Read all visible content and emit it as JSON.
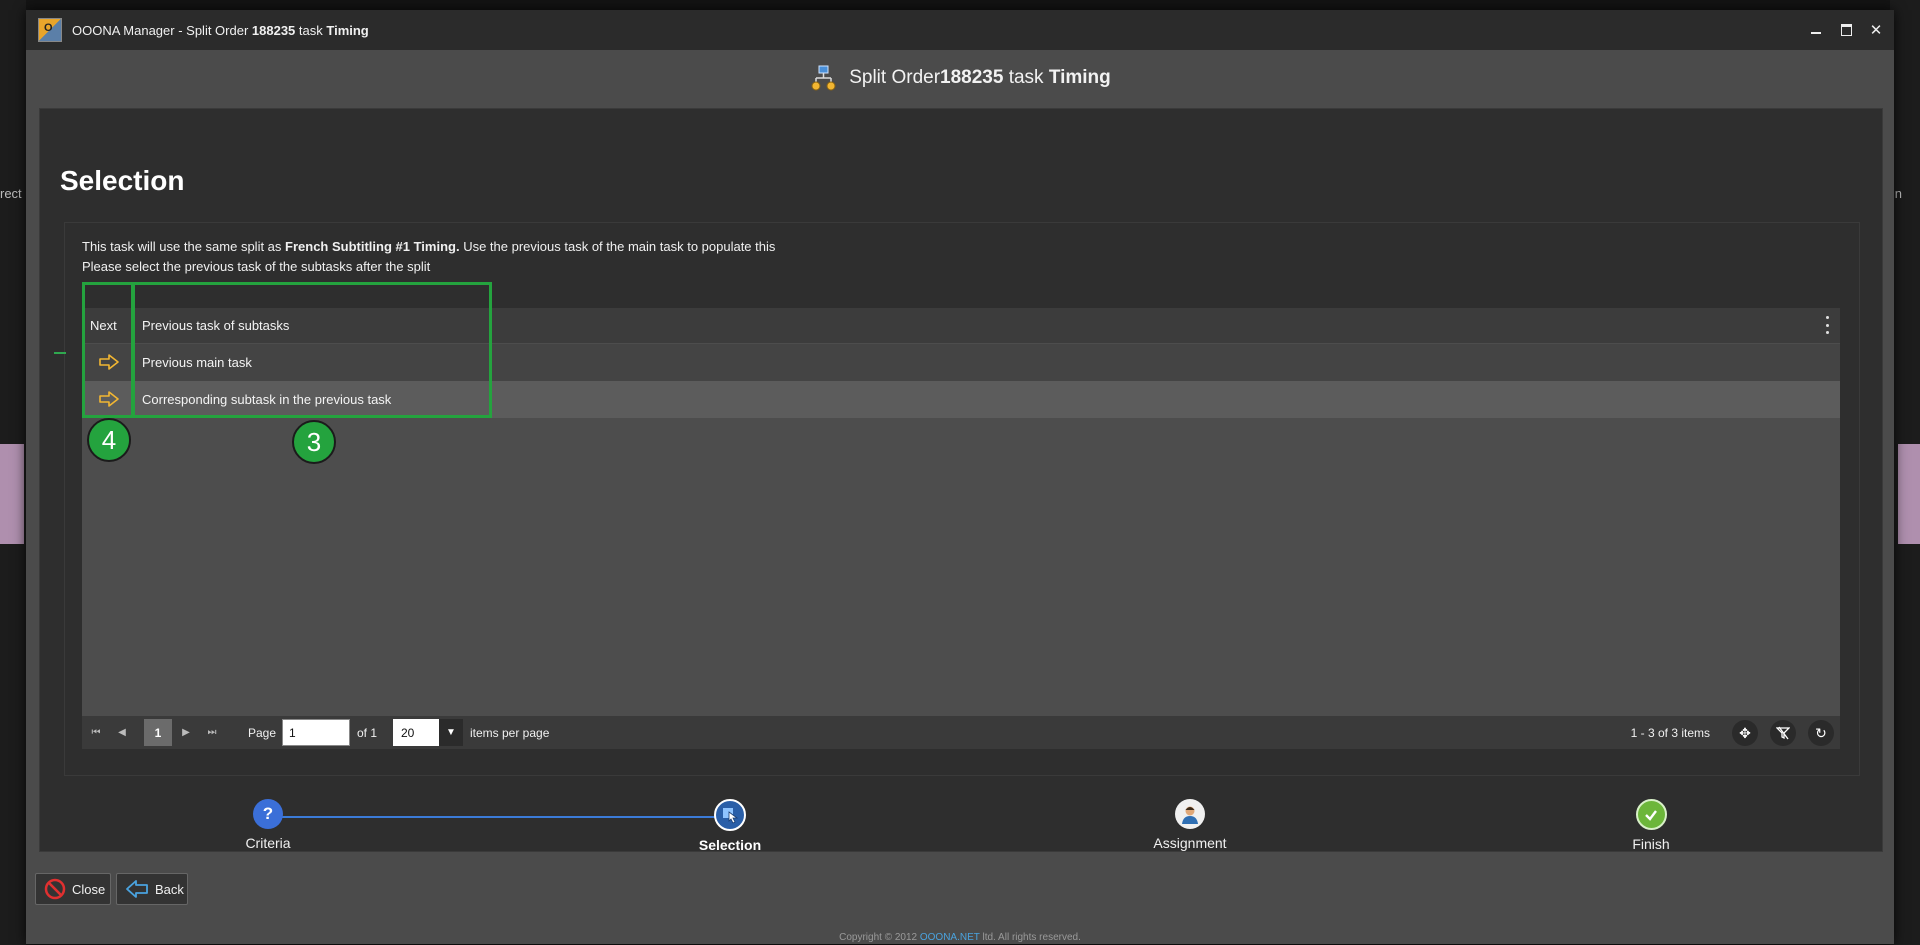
{
  "window": {
    "title_prefix": "OOONA Manager - Split Order ",
    "title_order": "188235",
    "title_mid": " task ",
    "title_task": "Timing",
    "logo_text": "O"
  },
  "header": {
    "prefix": "Split Order ",
    "order": "188235",
    "mid": " task ",
    "task": "Timing"
  },
  "section": {
    "title": "Selection",
    "desc_line1_a": "This task will use the same split as ",
    "desc_line1_b": "French Subtitling #1 Timing.",
    "desc_line1_c": " Use the previous task of the main task to populate this",
    "desc_line2": "Please select the previous task of the subtasks after the split"
  },
  "grid": {
    "columns": [
      "Next",
      "Previous task of subtasks"
    ],
    "rows": [
      {
        "label": "Previous main task"
      },
      {
        "label": "Corresponding subtask in the previous task"
      }
    ]
  },
  "annotations": {
    "badge_next": "4",
    "badge_prev": "3"
  },
  "pager": {
    "current_page": "1",
    "page_label": "Page",
    "page_input": "1",
    "of_label": "of 1",
    "page_size": "20",
    "per_page_label": "items per page",
    "count": "1 - 3 of 3 items"
  },
  "steps": [
    {
      "label": "Criteria"
    },
    {
      "label": "Selection"
    },
    {
      "label": "Assignment"
    },
    {
      "label": "Finish"
    }
  ],
  "buttons": {
    "close": "Close",
    "back": "Back"
  },
  "background": {
    "left_text": "rect",
    "right_text": "n"
  },
  "footer": {
    "copyright_a": "Copyright © 2012 ",
    "copyright_brand": "OOONA.NET",
    "copyright_b": " ltd. All rights reserved."
  },
  "colors": {
    "accent_green": "#24a33e",
    "step_line": "#3b7bd8",
    "arrow_yellow": "#f2b632"
  }
}
